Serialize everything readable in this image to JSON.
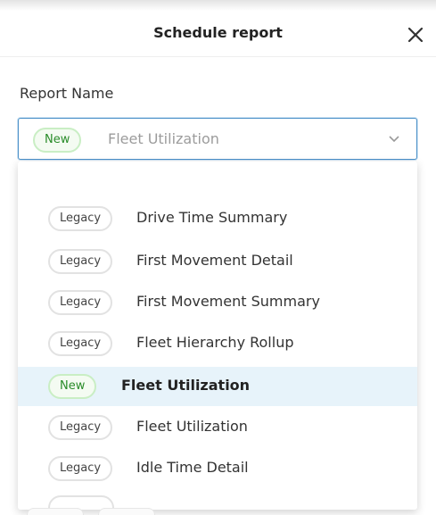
{
  "dialog": {
    "title": "Schedule report",
    "close_icon": "close-icon"
  },
  "field": {
    "label": "Report Name",
    "selected": {
      "badge": "New",
      "value": "Fleet Utilization"
    },
    "chevron_icon": "chevron-down-icon",
    "accent_color": "#4a90c8"
  },
  "options": [
    {
      "badge": "Legacy",
      "label": "Drive Time Summary"
    },
    {
      "badge": "Legacy",
      "label": "First Movement Detail"
    },
    {
      "badge": "Legacy",
      "label": "First Movement Summary"
    },
    {
      "badge": "Legacy",
      "label": "Fleet Hierarchy Rollup"
    },
    {
      "badge": "New",
      "label": "Fleet Utilization",
      "highlighted": true
    },
    {
      "badge": "Legacy",
      "label": "Fleet Utilization"
    },
    {
      "badge": "Legacy",
      "label": "Idle Time Detail"
    }
  ],
  "colors": {
    "new_badge_text": "#2a8c2a",
    "new_badge_border": "#c9eec4",
    "legacy_badge_border": "#e2e2e2",
    "highlight_bg": "#e7f3fa"
  }
}
